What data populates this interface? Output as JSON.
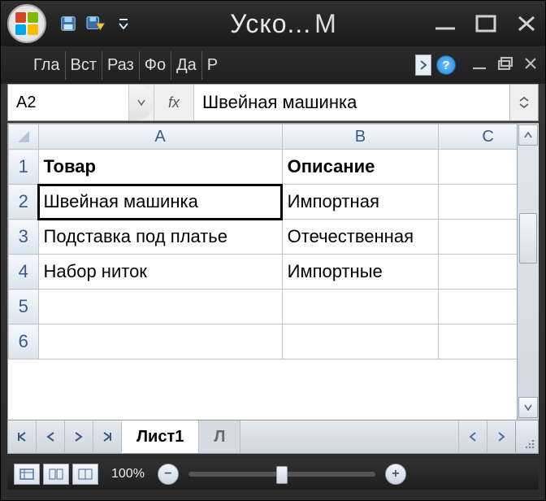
{
  "window": {
    "title_left": "Уско...",
    "title_right": "М"
  },
  "qat": {
    "save_icon": "save-icon",
    "saveas_icon": "save-as-icon",
    "more_icon": "chevron-down-icon"
  },
  "ribbon": {
    "tabs": [
      "Гла",
      "Вст",
      "Раз",
      "Фо",
      "Да",
      "Р"
    ]
  },
  "namebox": {
    "ref": "A2"
  },
  "formula_bar": {
    "fx_label": "fx",
    "value": "Швейная машинка"
  },
  "grid": {
    "columns": [
      "A",
      "B",
      "C"
    ],
    "row_numbers": [
      "1",
      "2",
      "3",
      "4",
      "5",
      "6"
    ],
    "rows": [
      {
        "a": "Товар",
        "b": "Описание",
        "c": "",
        "bold": true
      },
      {
        "a": "Швейная машинка",
        "b": "Импортная",
        "c": "",
        "selected": true
      },
      {
        "a": "Подставка под платье",
        "b": "Отечественная",
        "c": ""
      },
      {
        "a": "Набор ниток",
        "b": "Импортные",
        "c": ""
      },
      {
        "a": "",
        "b": "",
        "c": ""
      },
      {
        "a": "",
        "b": "",
        "c": ""
      }
    ]
  },
  "sheets": {
    "active": "Лист1",
    "next": "Л"
  },
  "status": {
    "zoom": "100%"
  }
}
